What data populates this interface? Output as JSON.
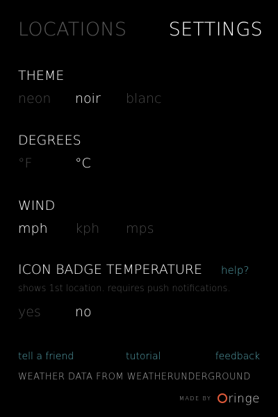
{
  "tabs": {
    "locations": "LOCATIONS",
    "settings": "SETTINGS",
    "active": "settings"
  },
  "theme": {
    "title": "THEME",
    "options": [
      "neon",
      "noir",
      "blanc"
    ],
    "selected": "noir"
  },
  "degrees": {
    "title": "DEGREES",
    "options": [
      "°F",
      "°C"
    ],
    "selected": "°C"
  },
  "wind": {
    "title": "WIND",
    "options": [
      "mph",
      "kph",
      "mps"
    ],
    "selected": "mph"
  },
  "badge": {
    "title": "ICON BADGE TEMPERATURE",
    "help": "help?",
    "description": "shows 1st location. requires push notifications.",
    "options": [
      "yes",
      "no"
    ],
    "selected": "no"
  },
  "links": {
    "tell_friend": "tell a friend",
    "tutorial": "tutorial",
    "feedback": "feedback"
  },
  "credit": "WEATHER DATA FROM WEATHERUNDERGROUND",
  "made_by": {
    "label": "MADE BY",
    "logo_rest": "ringe"
  },
  "colors": {
    "background": "#000000",
    "active": "#ffffff",
    "inactive": "#4a4a4a",
    "link": "#57a3ad",
    "logo_accent": "#e05a3a"
  }
}
